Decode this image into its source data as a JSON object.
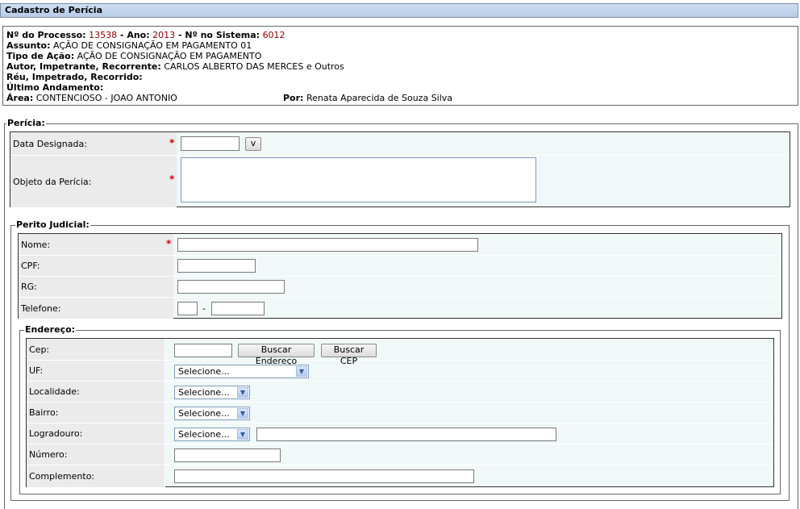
{
  "header": {
    "title": "Cadastro de Perícia"
  },
  "info": {
    "processo_label": "Nº do Processo:",
    "processo": "13538",
    "ano_sep": " - ",
    "ano_label": "Ano:",
    "ano": "2013",
    "sistema_sep": " - ",
    "sistema_label": "Nº no Sistema:",
    "sistema": "6012",
    "assunto_label": "Assunto:",
    "assunto": "AÇÃO DE CONSIGNAÇÃO EM PAGAMENTO 01",
    "tipo_label": "Tipo de Ação:",
    "tipo": "AÇÃO DE CONSIGNAÇÃO EM PAGAMENTO",
    "autor_label": "Autor, Impetrante, Recorrente:",
    "autor": "CARLOS ALBERTO DAS MERCES e Outros",
    "reu_label": "Réu, Impetrado, Recorrido:",
    "reu": "",
    "andamento_label": "Último Andamento:",
    "andamento": "",
    "area_label": "Área:",
    "area": "CONTENCIOSO - JOAO ANTONIO",
    "por_label": "Por:",
    "por": "Renata Aparecida de Souza Silva"
  },
  "pericia": {
    "legend": "Perícia:",
    "data_label": "Data Designada:",
    "data_value": "",
    "calendar_button": "v",
    "objeto_label": "Objeto da Perícia:",
    "objeto_value": "",
    "required_mark": "*"
  },
  "perito": {
    "legend": "Perito Judicial:",
    "nome_label": "Nome:",
    "nome_value": "",
    "cpf_label": "CPF:",
    "cpf_value": "",
    "rg_label": "RG:",
    "rg_value": "",
    "telefone_label": "Telefone:",
    "ddd_value": "",
    "telefone_sep": "-",
    "telefone_value": ""
  },
  "endereco": {
    "legend": "Endereço:",
    "cep_label": "Cep:",
    "cep_value": "",
    "buscar_endereco": "Buscar Endereço",
    "buscar_cep": "Buscar CEP",
    "uf_label": "UF:",
    "uf_selected": "Selecione...",
    "localidade_label": "Localidade:",
    "localidade_selected": "Selecione...",
    "bairro_label": "Bairro:",
    "bairro_selected": "Selecione...",
    "logradouro_label": "Logradouro:",
    "logradouro_selected": "Selecione...",
    "logradouro_value": "",
    "numero_label": "Número:",
    "numero_value": "",
    "complemento_label": "Complemento:",
    "complemento_value": "",
    "dropdown_arrow": "▼"
  }
}
